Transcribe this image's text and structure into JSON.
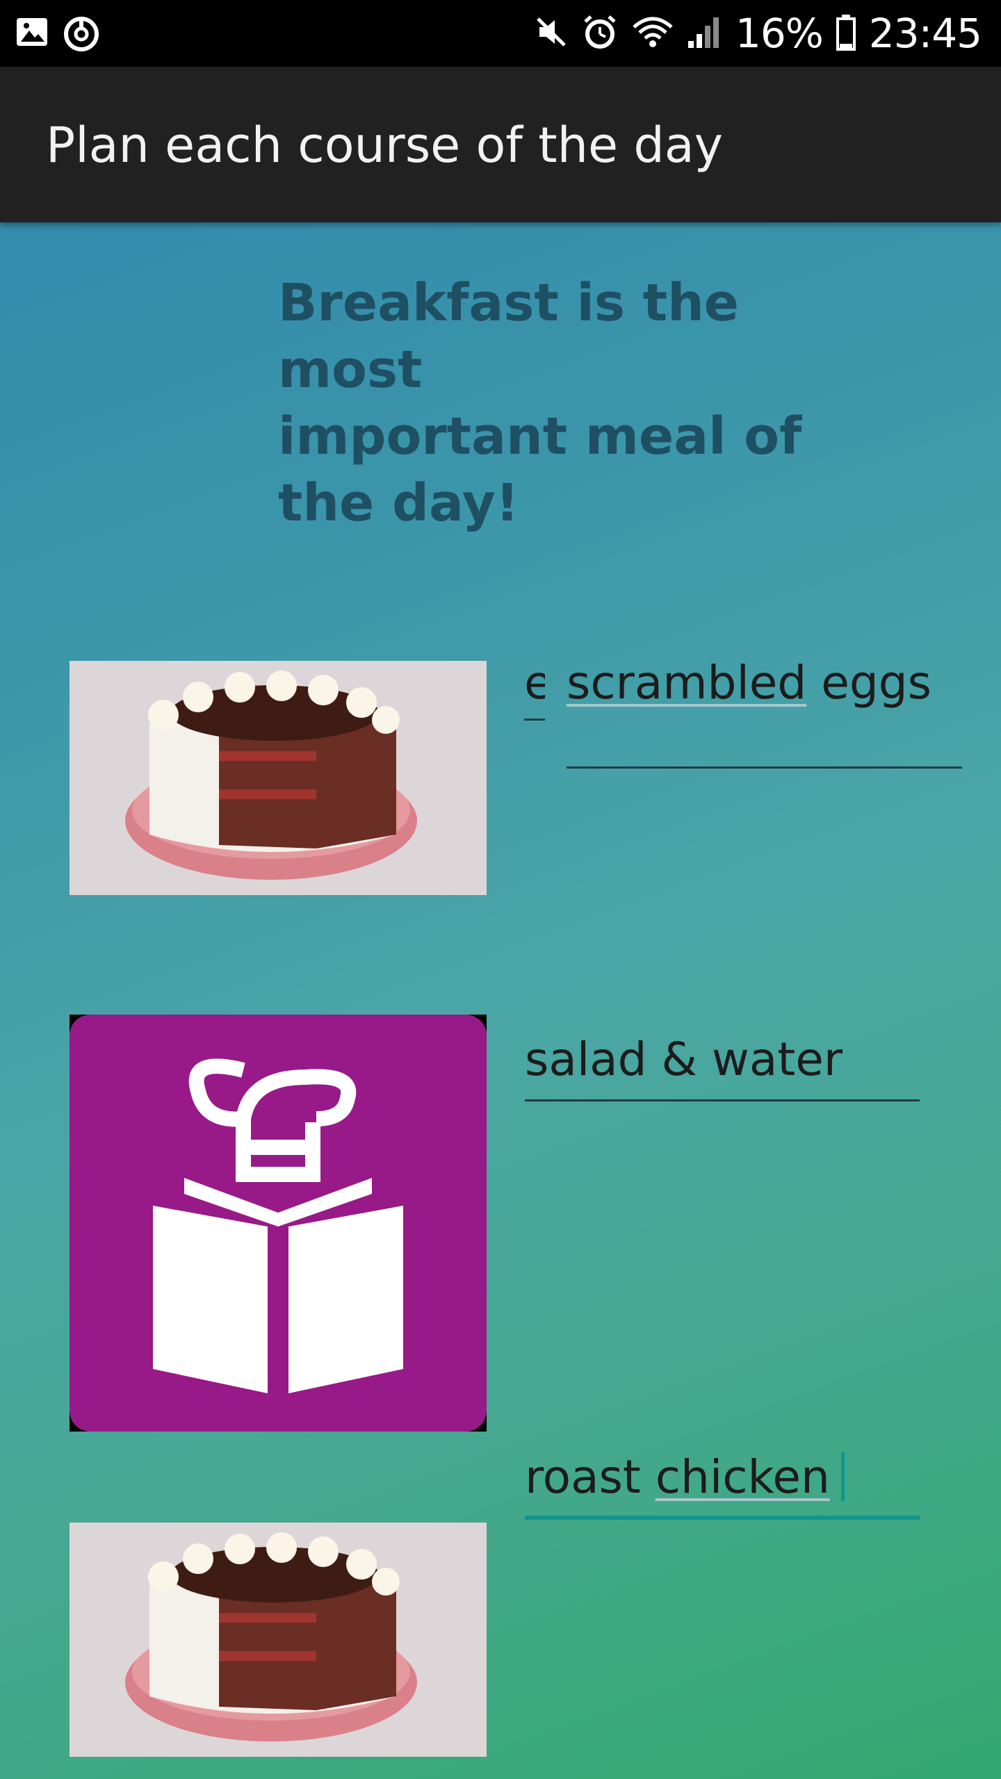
{
  "status_bar": {
    "battery_percent": "16%",
    "time": "23:45",
    "left_icons": [
      "image-icon",
      "sync-icon"
    ],
    "right_icons": [
      "mute-icon",
      "alarm-icon",
      "wifi-icon",
      "signal-icon",
      "battery-icon"
    ]
  },
  "app_bar": {
    "title": "Plan each course of the day"
  },
  "headline": {
    "line1": "Breakfast is the most",
    "line2": "important meal of",
    "line3": "the day!"
  },
  "courses": [
    {
      "image": "cake-image",
      "clipped_prefix": "e",
      "value_parts": [
        "scrambled",
        " eggs"
      ]
    },
    {
      "image": "chef-book-icon",
      "value": "salad & water"
    },
    {
      "image": "cake-image",
      "value_parts": [
        "roast ",
        "chicken"
      ]
    }
  ],
  "colors": {
    "app_bar": "#212121",
    "accent": "#12958f",
    "headline_text": "#1f4f63",
    "chef_icon_bg": "#981a88"
  }
}
